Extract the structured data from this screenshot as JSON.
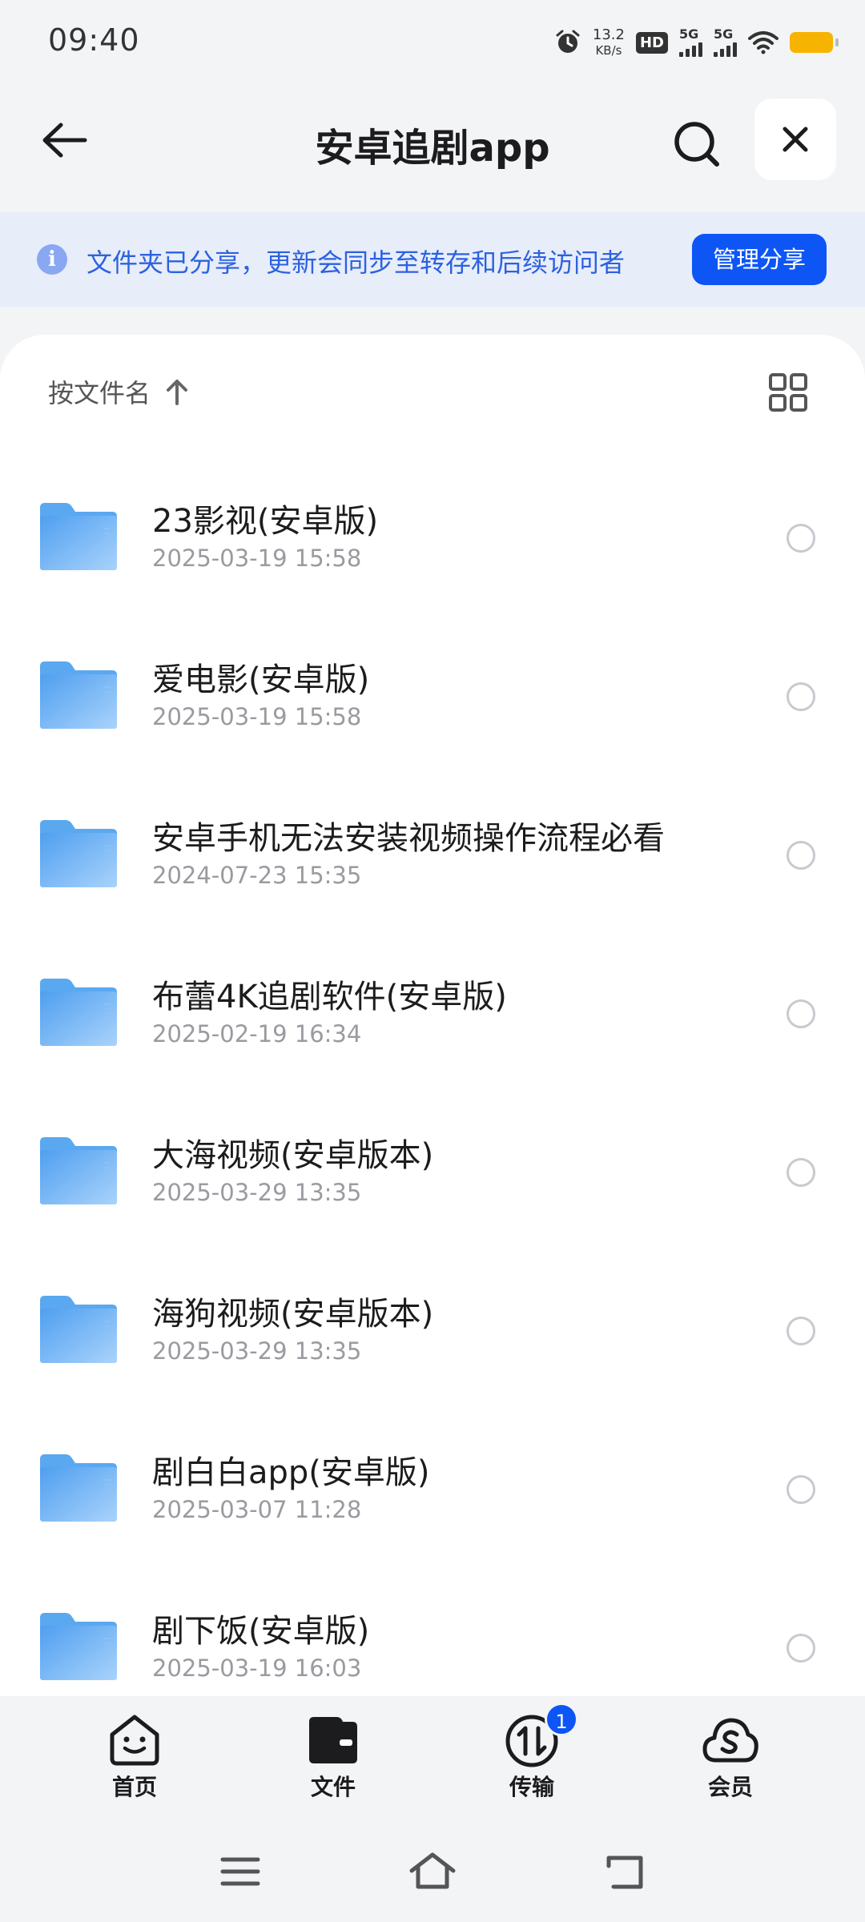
{
  "status_bar": {
    "time": "09:40",
    "net_speed_value": "13.2",
    "net_speed_unit": "KB/s",
    "hd_label": "HD",
    "sim1_label": "5G",
    "sim2_label": "5G",
    "battery_color": "#f6b400"
  },
  "header": {
    "title": "安卓追剧app",
    "back_icon": "arrow-left-icon",
    "search_icon": "search-icon",
    "close_icon": "close-icon"
  },
  "banner": {
    "info_glyph": "i",
    "text": "文件夹已分享，更新会同步至转存和后续访问者",
    "button_label": "管理分享"
  },
  "sort": {
    "label": "按文件名",
    "direction_icon": "arrow-up-icon",
    "view_icon": "grid-view-icon"
  },
  "files": [
    {
      "name": "23影视(安卓版)",
      "date": "2025-03-19 15:58"
    },
    {
      "name": "爱电影(安卓版)",
      "date": "2025-03-19 15:58"
    },
    {
      "name": "安卓手机无法安装视频操作流程必看",
      "date": "2024-07-23 15:35"
    },
    {
      "name": "布蕾4K追剧软件(安卓版)",
      "date": "2025-02-19 16:34"
    },
    {
      "name": "大海视频(安卓版本)",
      "date": "2025-03-29 13:35"
    },
    {
      "name": "海狗视频(安卓版本)",
      "date": "2025-03-29 13:35"
    },
    {
      "name": "剧白白app(安卓版)",
      "date": "2025-03-07 11:28"
    },
    {
      "name": "剧下饭(安卓版)",
      "date": "2025-03-19 16:03"
    }
  ],
  "bottom_nav": {
    "items": [
      {
        "label": "首页",
        "icon": "home-face-icon"
      },
      {
        "label": "文件",
        "icon": "folder-wallet-icon"
      },
      {
        "label": "传输",
        "icon": "transfer-icon",
        "badge": "1"
      },
      {
        "label": "会员",
        "icon": "cloud-vip-icon"
      }
    ]
  },
  "colors": {
    "accent": "#0d55f5",
    "banner_bg": "#e8edfa",
    "banner_text": "#2c62e0",
    "folder_blue": "#5aa8f0"
  }
}
